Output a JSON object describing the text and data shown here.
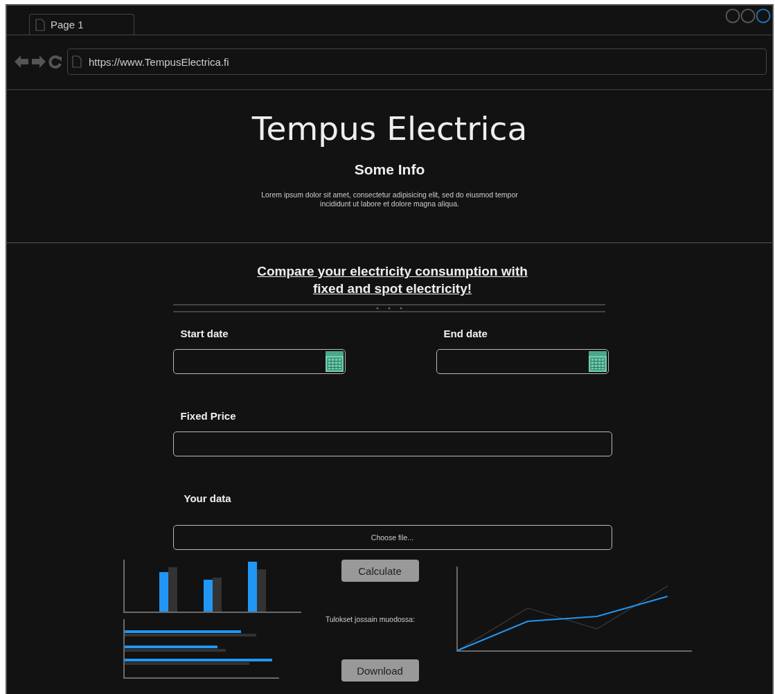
{
  "browser": {
    "tab": "Page 1",
    "url": "https://www.TempusElectrica.fi"
  },
  "header": {
    "title": "Tempus Electrica",
    "subtitle": "Some Info",
    "body": "Lorem ipsum dolor sit amet, consectetur adipisicing elit, sed do eiusmod tempor incididunt ut labore et dolore magna aliqua."
  },
  "form": {
    "heading": "Compare your electricity consumption with fixed and spot electricity!",
    "fields": [
      {
        "kind": "date",
        "label": "Start date"
      },
      {
        "kind": "date",
        "label": "End date"
      },
      {
        "kind": "text",
        "label": "Fixed Price"
      },
      {
        "kind": "file",
        "label": "Your data",
        "value": "Choose file..."
      }
    ],
    "calculate": "Calculate",
    "results": "Tulokset jossain muodossa:",
    "download": "Download"
  }
}
